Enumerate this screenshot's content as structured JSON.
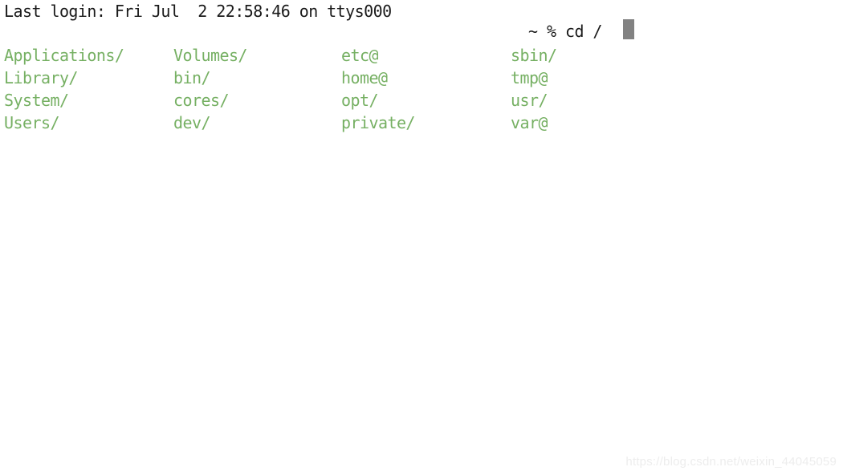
{
  "terminal": {
    "background_color": "#ffffff",
    "foreground_color": "#1a1a1a",
    "directory_color": "#76b063",
    "cursor_color": "#828282",
    "login_line": "Last login: Fri Jul  2 22:58:46 on ttys000",
    "prompt": {
      "redacted_label": "",
      "tail_text": "~ % cd /",
      "cursor": ""
    },
    "ls_output": {
      "rows": [
        {
          "c0": "Applications/",
          "c1": "Volumes/",
          "c2": "etc@",
          "c3": "sbin/"
        },
        {
          "c0": "Library/",
          "c1": "bin/",
          "c2": "home@",
          "c3": "tmp@"
        },
        {
          "c0": "System/",
          "c1": "cores/",
          "c2": "opt/",
          "c3": "usr/"
        },
        {
          "c0": "Users/",
          "c1": "dev/",
          "c2": "private/",
          "c3": "var@"
        }
      ]
    }
  },
  "watermark": {
    "text": "https://blog.csdn.net/weixin_44045059"
  }
}
